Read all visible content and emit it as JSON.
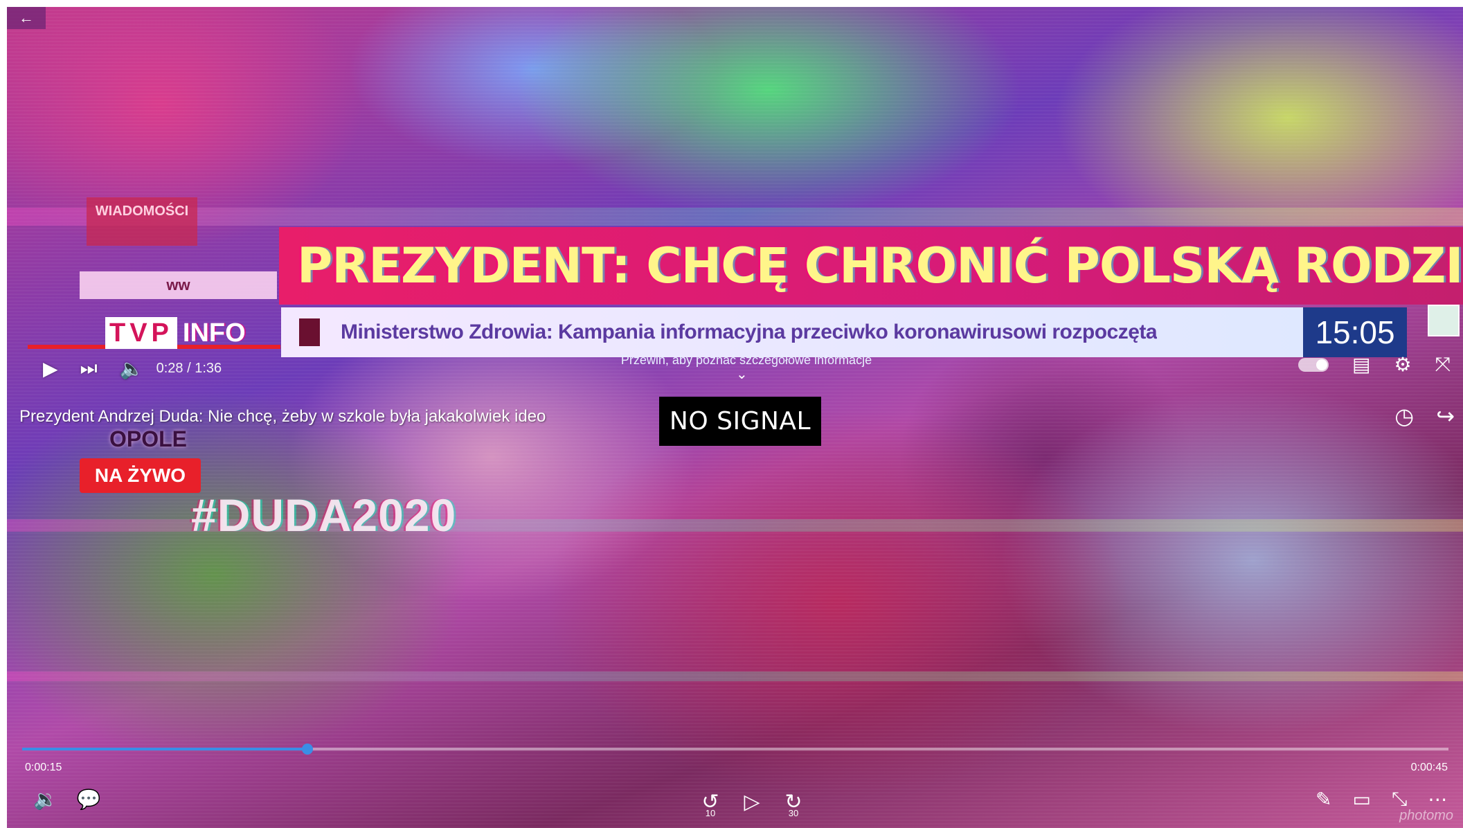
{
  "player": {
    "back_icon": "arrow-left-icon",
    "no_signal": "NO SIGNAL",
    "position": "0:00:15",
    "duration": "0:00:45",
    "progress_fraction": 0.2,
    "skip_back_label": "10",
    "skip_forward_label": "30",
    "watermark": "photomo"
  },
  "broadcast": {
    "headline": "PREZYDENT: CHCĘ CHRONIĆ POLSKĄ RODZINĘ",
    "logo_box_text": "WIADOMOŚCI",
    "logo_sub_text": "ww",
    "channel_letters": "TVP",
    "channel_info": "INFO",
    "ticker": "Ministerstwo Zdrowia: Kampania informacyjna przeciwko koronawirusowi rozpoczęta",
    "clock": "15:05",
    "location": "OPOLE",
    "live_badge": "NA ŻYWO",
    "hashtag": "#DUDA2020"
  },
  "embedded_player": {
    "time": "0:28 / 1:36",
    "swipe_hint": "Przewiń, aby poznać szczegółowe informacje",
    "video_title": "Prezydent Andrzej Duda: Nie chcę, żeby w szkole była jakakolwiek ideo"
  },
  "colors": {
    "headline_bg": "#e81e6a",
    "headline_text": "#fff58a",
    "clock_bg": "#1e3a8a",
    "live_red": "#e8202a",
    "seek_blue": "#3a8ee6"
  }
}
